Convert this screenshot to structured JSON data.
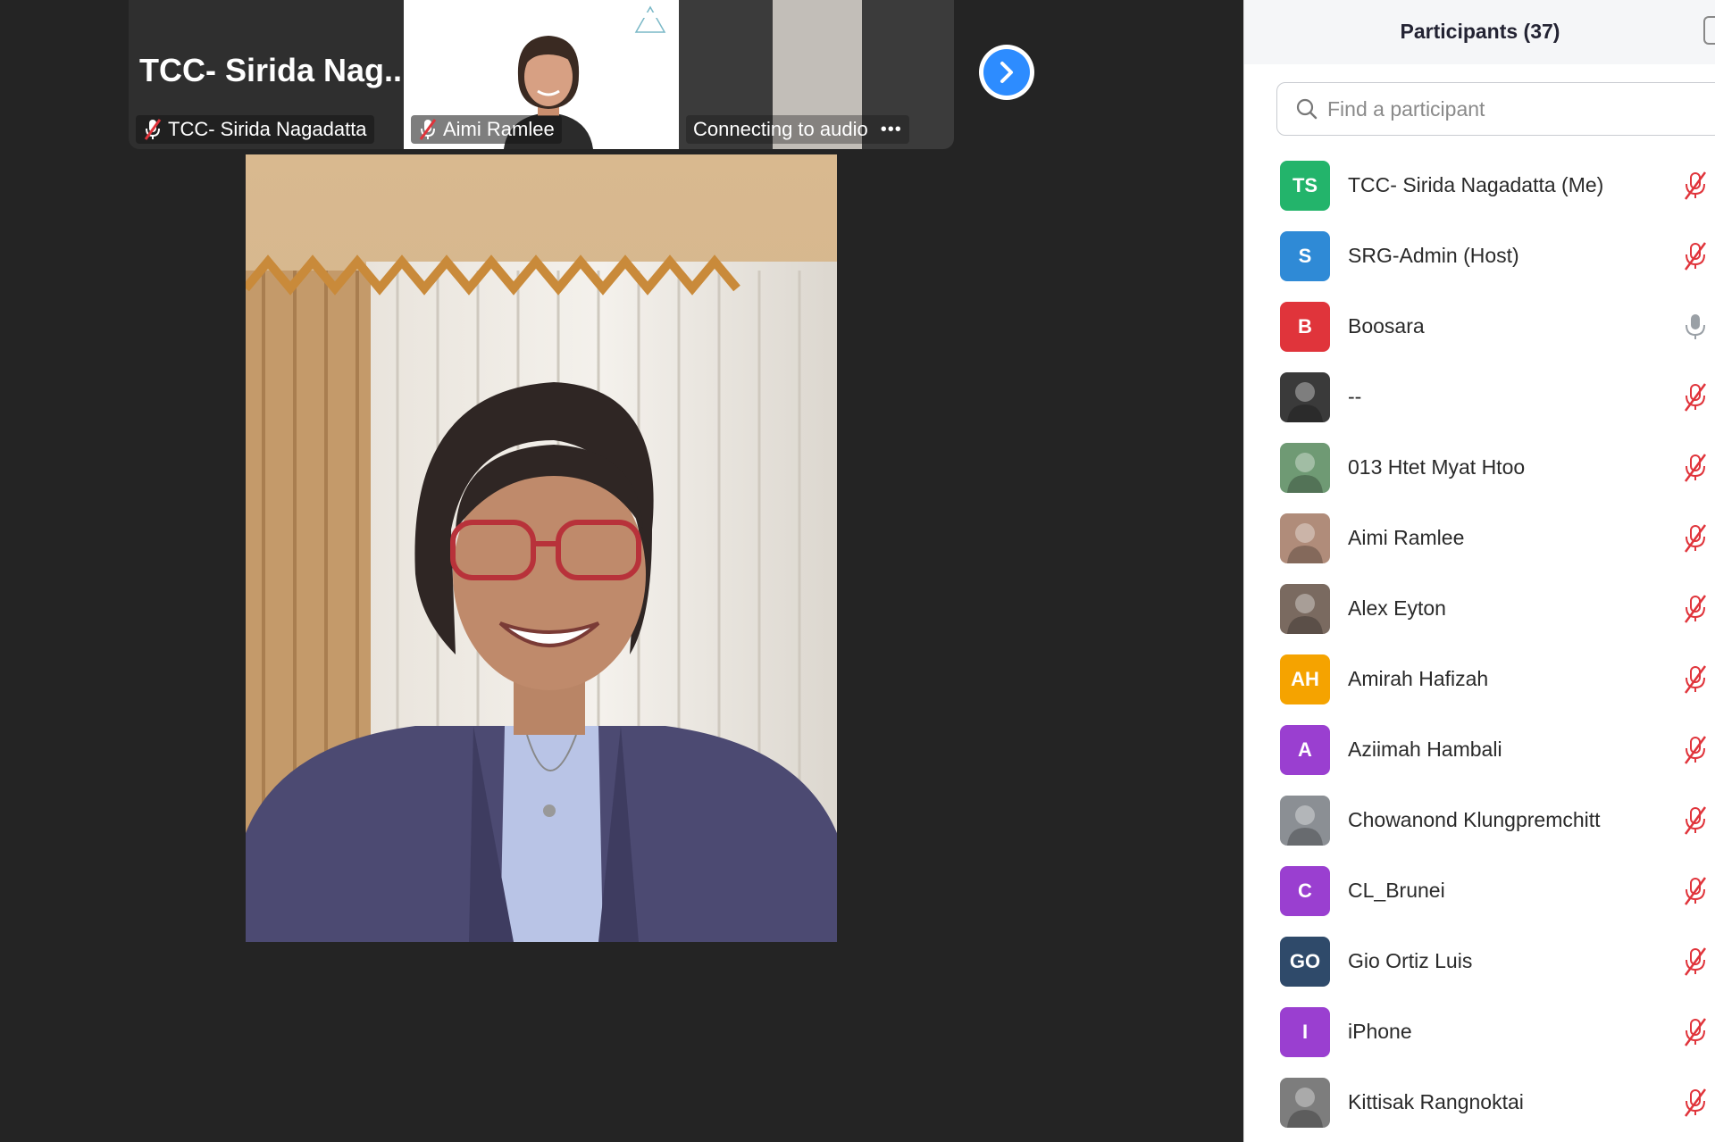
{
  "thumbnails": [
    {
      "big_name": "TCC- Sirida Nag...",
      "label": "TCC- Sirida Nagadatta",
      "muted": true
    },
    {
      "label": "Aimi Ramlee",
      "muted": true
    },
    {
      "label": "Connecting to audio",
      "status_dots": "•••"
    }
  ],
  "participants_panel": {
    "title": "Participants (37)",
    "search_placeholder": "Find a participant",
    "items": [
      {
        "initials": "TS",
        "name": "TCC- Sirida Nagadatta (Me)",
        "color": "#23b46b",
        "muted": true
      },
      {
        "initials": "S",
        "name": "SRG-Admin (Host)",
        "color": "#2f8ad6",
        "muted": true
      },
      {
        "initials": "B",
        "name": "Boosara",
        "color": "#e0343b",
        "muted": false
      },
      {
        "initials": "",
        "name": "--",
        "color": "#3a3a3a",
        "muted": true
      },
      {
        "initials": "",
        "name": "013 Htet Myat Htoo",
        "color": "#6f9a74",
        "muted": true
      },
      {
        "initials": "",
        "name": "Aimi Ramlee",
        "color": "#b08c7a",
        "muted": true
      },
      {
        "initials": "",
        "name": "Alex Eyton",
        "color": "#7a6a60",
        "muted": true
      },
      {
        "initials": "AH",
        "name": "Amirah Hafizah",
        "color": "#f5a300",
        "muted": true
      },
      {
        "initials": "A",
        "name": "Aziimah Hambali",
        "color": "#9a3fd0",
        "muted": true
      },
      {
        "initials": "",
        "name": "Chowanond Klungpremchitt",
        "color": "#8b8f94",
        "muted": true
      },
      {
        "initials": "C",
        "name": "CL_Brunei",
        "color": "#9a3fd0",
        "muted": true
      },
      {
        "initials": "GO",
        "name": "Gio Ortiz Luis",
        "color": "#2f4a6a",
        "muted": true
      },
      {
        "initials": "I",
        "name": "iPhone",
        "color": "#9a3fd0",
        "muted": true
      },
      {
        "initials": "",
        "name": "Kittisak Rangnoktai",
        "color": "#7d7d7d",
        "muted": true
      }
    ]
  },
  "colors": {
    "background": "#242424",
    "accent_blue": "#2d8cff",
    "muted_red": "#e0343b"
  }
}
